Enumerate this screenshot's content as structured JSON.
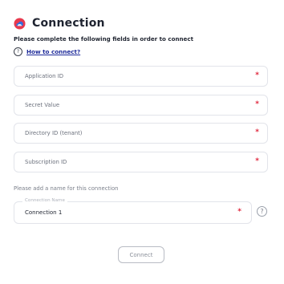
{
  "header": {
    "title": "Connection",
    "logo_icon": "azure-cloud-icon"
  },
  "subtitle": "Please complete the following fields in order to connect",
  "help_link": {
    "label": "How to connect?"
  },
  "fields": [
    {
      "placeholder": "Application ID",
      "required_mark": "*"
    },
    {
      "placeholder": "Secret Value",
      "required_mark": "*"
    },
    {
      "placeholder": "Directory ID (tenant)",
      "required_mark": "*"
    },
    {
      "placeholder": "Subscription ID",
      "required_mark": "*"
    }
  ],
  "name_section": {
    "prompt": "Please add a name for this connection",
    "floating_label": "Connection Name",
    "value": "Connection 1",
    "required_mark": "*",
    "help_glyph": "?"
  },
  "connect_button": {
    "label": "Connect"
  },
  "colors": {
    "required": "#e0263c",
    "link": "#1d2a9a",
    "border": "#e2e4ea"
  }
}
